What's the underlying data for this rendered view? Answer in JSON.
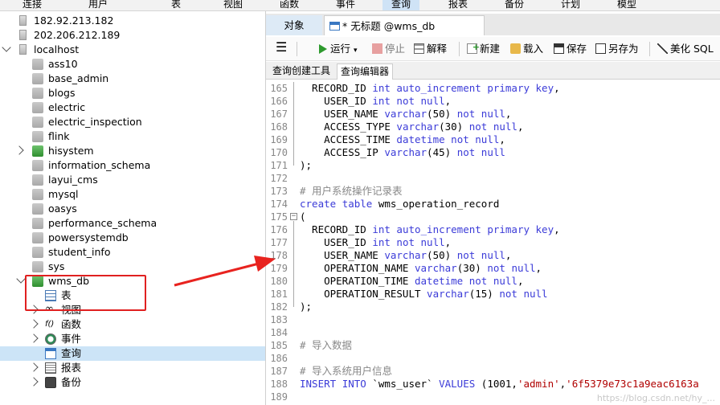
{
  "menu": [
    "连接",
    "用户",
    "表",
    "视图",
    "函数",
    "事件",
    "查询",
    "报表",
    "备份",
    "计划",
    "模型"
  ],
  "menu_active_index": 6,
  "tree": [
    {
      "label": "182.92.213.182",
      "type": "server",
      "indent": 0,
      "expander": "none"
    },
    {
      "label": "202.206.212.189",
      "type": "server",
      "indent": 0,
      "expander": "none"
    },
    {
      "label": "localhost",
      "type": "server",
      "indent": 0,
      "expander": "down"
    },
    {
      "label": "ass10",
      "type": "db",
      "indent": 1,
      "expander": "none"
    },
    {
      "label": "base_admin",
      "type": "db",
      "indent": 1,
      "expander": "none"
    },
    {
      "label": "blogs",
      "type": "db",
      "indent": 1,
      "expander": "none"
    },
    {
      "label": "electric",
      "type": "db",
      "indent": 1,
      "expander": "none"
    },
    {
      "label": "electric_inspection",
      "type": "db",
      "indent": 1,
      "expander": "none"
    },
    {
      "label": "flink",
      "type": "db",
      "indent": 1,
      "expander": "none"
    },
    {
      "label": "hisystem",
      "type": "db-open",
      "indent": 1,
      "expander": "right"
    },
    {
      "label": "information_schema",
      "type": "db",
      "indent": 1,
      "expander": "none"
    },
    {
      "label": "layui_cms",
      "type": "db",
      "indent": 1,
      "expander": "none"
    },
    {
      "label": "mysql",
      "type": "db",
      "indent": 1,
      "expander": "none"
    },
    {
      "label": "oasys",
      "type": "db",
      "indent": 1,
      "expander": "none"
    },
    {
      "label": "performance_schema",
      "type": "db",
      "indent": 1,
      "expander": "none"
    },
    {
      "label": "powersystemdb",
      "type": "db",
      "indent": 1,
      "expander": "none"
    },
    {
      "label": "student_info",
      "type": "db",
      "indent": 1,
      "expander": "none"
    },
    {
      "label": "sys",
      "type": "db",
      "indent": 1,
      "expander": "none"
    },
    {
      "label": "wms_db",
      "type": "db-open",
      "indent": 1,
      "expander": "down"
    },
    {
      "label": "表",
      "type": "table",
      "indent": 2,
      "expander": "none"
    },
    {
      "label": "视图",
      "type": "view",
      "indent": 2,
      "expander": "right"
    },
    {
      "label": "函数",
      "type": "func",
      "indent": 2,
      "expander": "right"
    },
    {
      "label": "事件",
      "type": "event",
      "indent": 2,
      "expander": "right"
    },
    {
      "label": "查询",
      "type": "query",
      "indent": 2,
      "expander": "none",
      "selected": true
    },
    {
      "label": "报表",
      "type": "report",
      "indent": 2,
      "expander": "right"
    },
    {
      "label": "备份",
      "type": "backup",
      "indent": 2,
      "expander": "right"
    }
  ],
  "tabs": {
    "objects": "对象",
    "query": "* 无标题 @wms_db (localho..."
  },
  "toolbar": {
    "menu_icon": "hamburger-icon",
    "run": "运行",
    "stop": "停止",
    "explain": "解释",
    "new": "新建",
    "load": "载入",
    "save": "保存",
    "save_as": "另存为",
    "beautify": "美化 SQL"
  },
  "subtabs": [
    "查询创建工具",
    "查询编辑器"
  ],
  "subtab_active_index": 1,
  "code_lines": [
    {
      "n": "165",
      "t": "  RECORD_ID int auto_increment primary key,"
    },
    {
      "n": "166",
      "t": "    USER_ID int not null,"
    },
    {
      "n": "167",
      "t": "    USER_NAME varchar(50) not null,"
    },
    {
      "n": "168",
      "t": "    ACCESS_TYPE varchar(30) not null,"
    },
    {
      "n": "169",
      "t": "    ACCESS_TIME datetime not null,"
    },
    {
      "n": "170",
      "t": "    ACCESS_IP varchar(45) not null"
    },
    {
      "n": "171",
      "t": ");"
    },
    {
      "n": "172",
      "t": ""
    },
    {
      "n": "173",
      "t": "# 用户系统操作记录表"
    },
    {
      "n": "174",
      "t": "create table wms_operation_record"
    },
    {
      "n": "175",
      "t": "("
    },
    {
      "n": "176",
      "t": "  RECORD_ID int auto_increment primary key,"
    },
    {
      "n": "177",
      "t": "    USER_ID int not null,"
    },
    {
      "n": "178",
      "t": "    USER_NAME varchar(50) not null,"
    },
    {
      "n": "179",
      "t": "    OPERATION_NAME varchar(30) not null,"
    },
    {
      "n": "180",
      "t": "    OPERATION_TIME datetime not null,"
    },
    {
      "n": "181",
      "t": "    OPERATION_RESULT varchar(15) not null"
    },
    {
      "n": "182",
      "t": ");"
    },
    {
      "n": "183",
      "t": ""
    },
    {
      "n": "184",
      "t": ""
    },
    {
      "n": "185",
      "t": "# 导入数据"
    },
    {
      "n": "186",
      "t": ""
    },
    {
      "n": "187",
      "t": "# 导入系统用户信息"
    },
    {
      "n": "188",
      "t": "INSERT INTO `wms_user` VALUES (1001,'admin','6f5379e73c1a9eac6163a"
    },
    {
      "n": "189",
      "t": ""
    }
  ],
  "watermark": "https://blog.csdn.net/hy_..."
}
